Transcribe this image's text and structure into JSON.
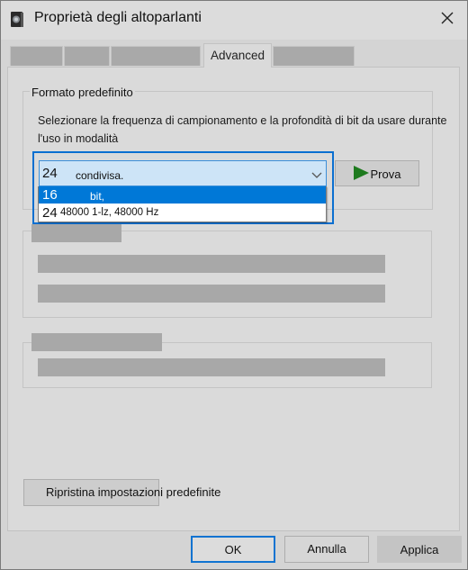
{
  "window": {
    "title": "Proprietà degli altoparlanti",
    "icon": "speaker-icon",
    "close_icon": "close-icon"
  },
  "tabs": [
    {
      "label": "",
      "redacted": true
    },
    {
      "label": "",
      "redacted": true
    },
    {
      "label": "",
      "redacted": true
    },
    {
      "label": "Advanced",
      "active": true
    },
    {
      "label": "",
      "redacted": true
    }
  ],
  "default_format": {
    "legend": "Formato predefinito",
    "description_line1": "Selezionare la frequenza di campionamento e la profondità di bit da usare durante",
    "description_line2": "l'uso in modalità",
    "combo": {
      "value_number": "24",
      "value_text": "condivisa.",
      "chevron_icon": "chevron-down-icon"
    },
    "options": [
      {
        "number": "16",
        "text": "bit,",
        "selected": true
      },
      {
        "number": "24",
        "text": "48000 1-lz, 48000 Hz",
        "selected": false
      }
    ],
    "test_button": {
      "label": "Prova",
      "icon": "play-icon",
      "icon_color": "#1e7a1e"
    }
  },
  "redacted_groups": [
    {
      "legend": "",
      "rows": 2
    },
    {
      "legend": "",
      "rows": 1
    }
  ],
  "restore_button": {
    "label": "Ripristina impostazioni predefinite"
  },
  "footer": {
    "ok_label": "OK",
    "cancel_label": "Annulla",
    "apply_label": "Applica"
  },
  "colors": {
    "accent": "#0078d7",
    "combo_bg": "#cde4f7",
    "dialog_bg": "#dadada"
  }
}
